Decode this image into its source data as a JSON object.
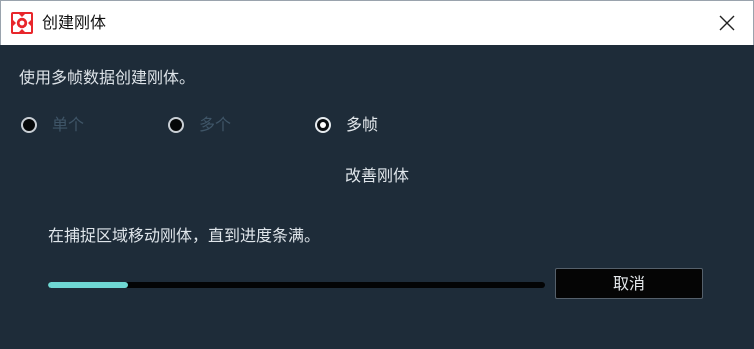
{
  "window": {
    "title": "创建刚体",
    "app_icon": "app-logo-icon",
    "close_icon": "close-icon"
  },
  "instruction": "使用多帧数据创建刚体。",
  "modes": [
    {
      "label": "单个",
      "selected": false,
      "enabled": false
    },
    {
      "label": "多个",
      "selected": false,
      "enabled": false
    },
    {
      "label": "多帧",
      "selected": true,
      "enabled": true
    }
  ],
  "section_title": "改善刚体",
  "hint": "在捕捉区域移动刚体，直到进度条满。",
  "progress": {
    "value": 0.16,
    "color": "#6fd8d4"
  },
  "cancel_label": "取消",
  "colors": {
    "accent": "#6fd8d4",
    "background": "#1e2c39",
    "brand": "#e8262b"
  }
}
